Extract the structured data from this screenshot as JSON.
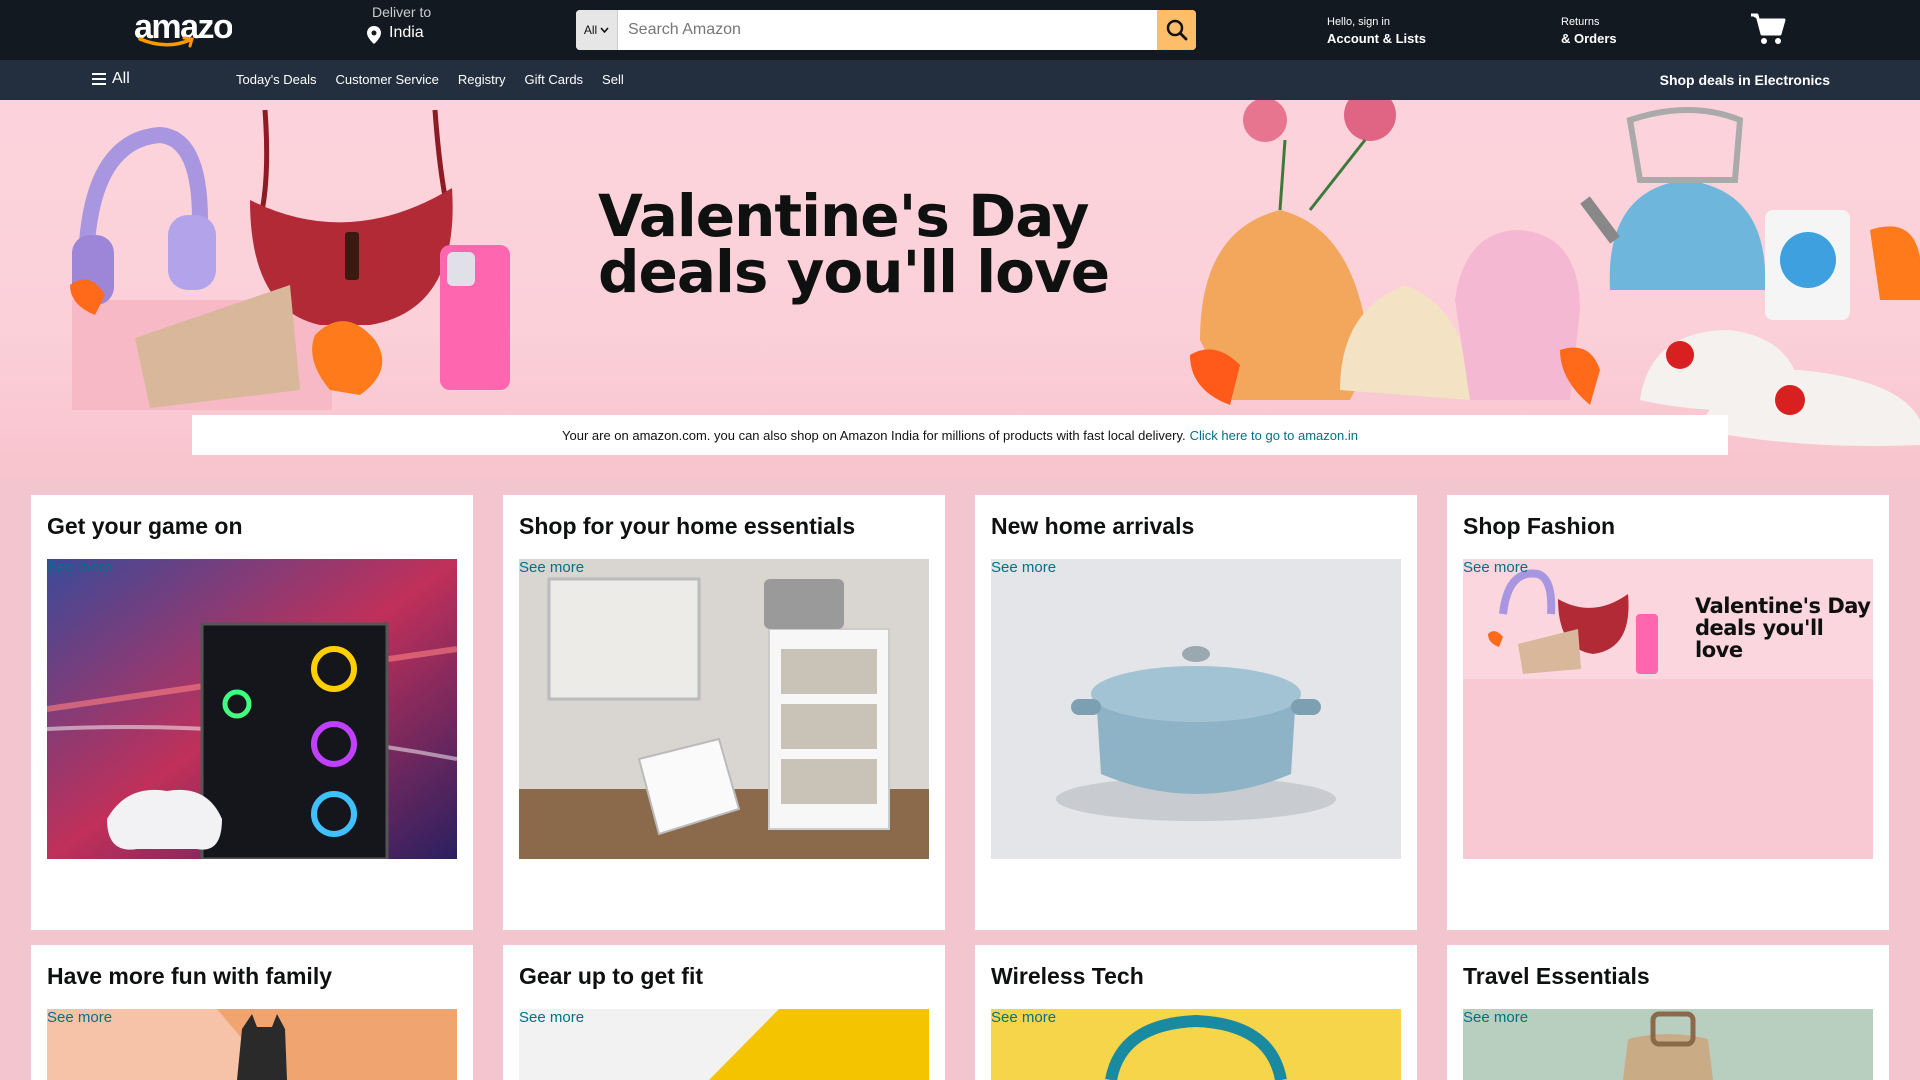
{
  "header": {
    "logo_text": "amazon",
    "deliver_label": "Deliver to",
    "deliver_location": "India",
    "search": {
      "category": "All",
      "placeholder": "Search Amazon"
    },
    "account_small": "Hello, sign in",
    "account_big": "Account & Lists",
    "returns_small": "Returns",
    "returns_big": "& Orders"
  },
  "subnav": {
    "all_label": "All",
    "links": [
      "Today's Deals",
      "Customer Service",
      "Registry",
      "Gift Cards",
      "Sell"
    ],
    "promo": "Shop deals in Electronics"
  },
  "hero": {
    "title_line1": "Valentine's Day",
    "title_line2": "deals you'll love"
  },
  "notice": {
    "text": "Your are on amazon.com. you can also shop on Amazon India for millions of products with fast local delivery.",
    "link": "Click here to go to amazon.in"
  },
  "cards": [
    {
      "title": "Get your game on",
      "see_more": "See more"
    },
    {
      "title": "Shop for your home essentials",
      "see_more": "See more"
    },
    {
      "title": "New home arrivals",
      "see_more": "See more"
    },
    {
      "title": "Shop Fashion",
      "see_more": "See more",
      "image_text_1": "Valentine's Day",
      "image_text_2": "deals you'll love"
    },
    {
      "title": "Have more fun with family",
      "see_more": "See more"
    },
    {
      "title": "Gear up to get fit",
      "see_more": "See more"
    },
    {
      "title": "Wireless Tech",
      "see_more": "See more"
    },
    {
      "title": "Travel Essentials",
      "see_more": "See more"
    }
  ],
  "colors": {
    "topbar": "#131921",
    "subnav": "#232f3e",
    "search_button": "#febd69",
    "link": "#007185",
    "hero_bg": "#fcd3dc"
  }
}
